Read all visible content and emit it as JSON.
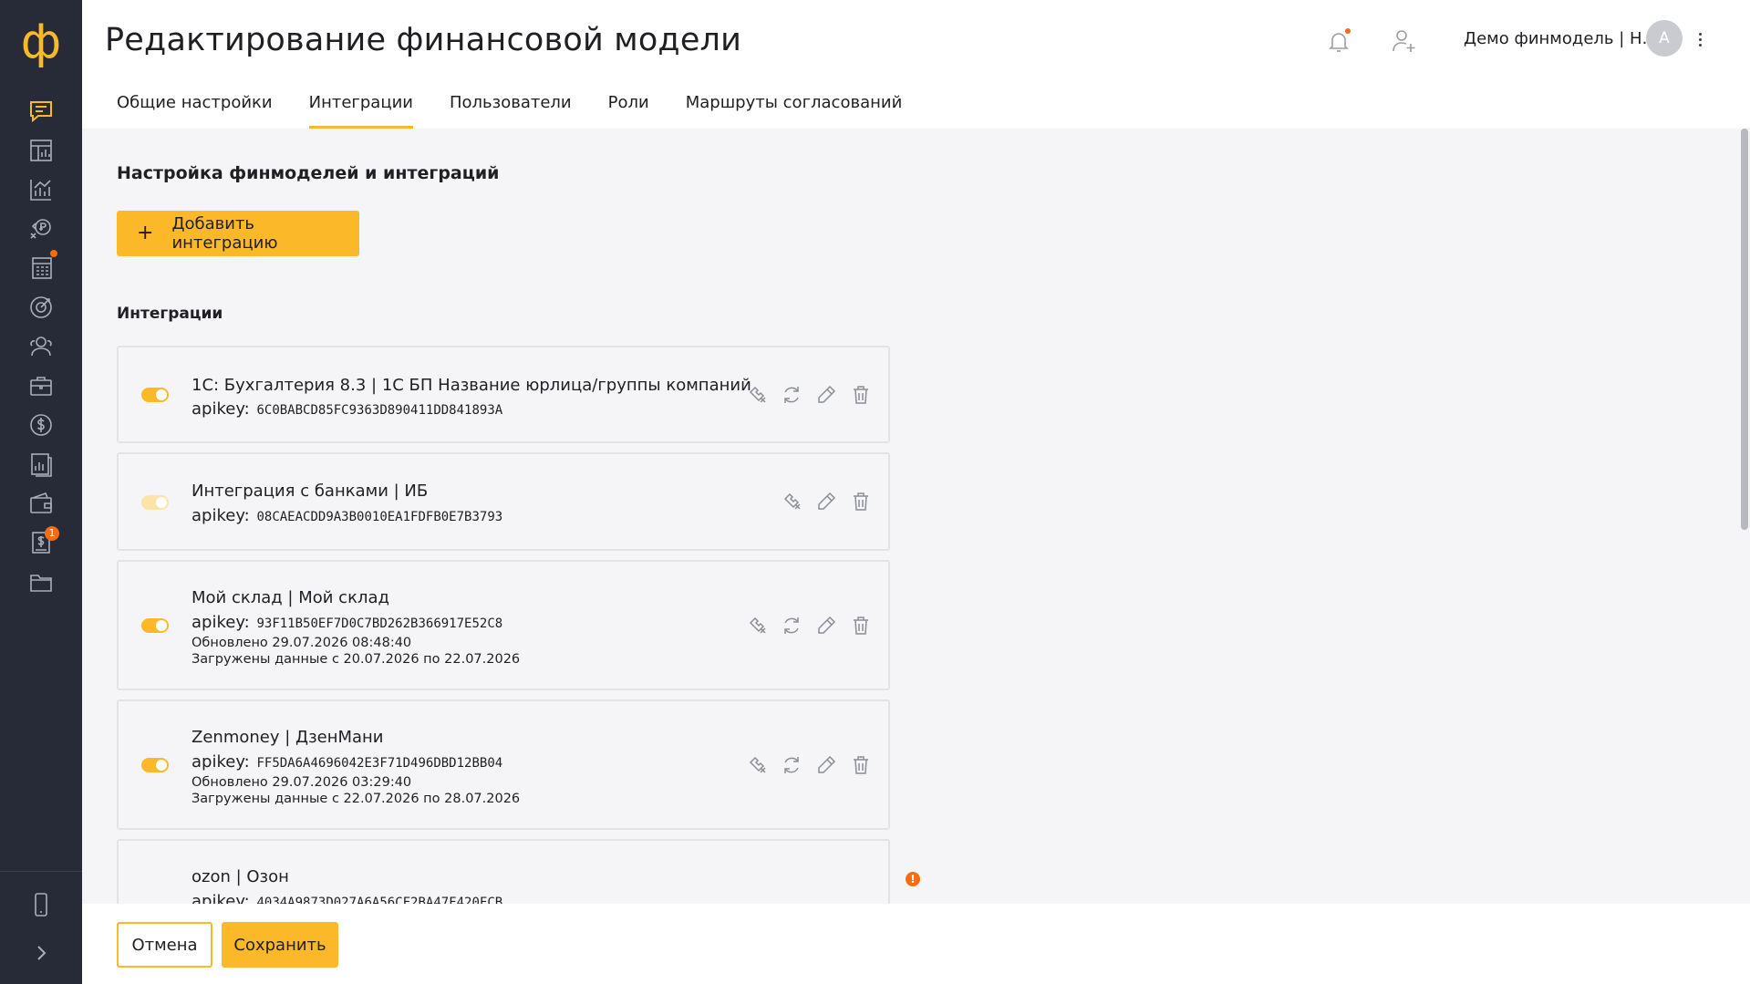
{
  "sidebar": {
    "logo": "ф",
    "icons": [
      {
        "name": "messages-icon",
        "active": true
      },
      {
        "name": "dashboard-icon"
      },
      {
        "name": "analytics-chart-icon"
      },
      {
        "name": "payments-exchange-icon",
        "dot": true
      },
      {
        "name": "budget-calculator-icon",
        "dot": true
      },
      {
        "name": "goals-target-icon"
      },
      {
        "name": "users-group-icon"
      },
      {
        "name": "briefcase-icon"
      },
      {
        "name": "dollar-coin-icon"
      },
      {
        "name": "reports-icon"
      },
      {
        "name": "wallet-icon"
      },
      {
        "name": "invoices-icon",
        "badge": "1"
      },
      {
        "name": "folder-icon"
      }
    ],
    "bottom": [
      {
        "name": "mobile-app-icon"
      },
      {
        "name": "expand-chevron-icon"
      }
    ],
    "invoices_badge": "1"
  },
  "header": {
    "title": "Редактирование финансовой модели",
    "account_name": "Демо финмодель | Н...",
    "avatar_letter": "А"
  },
  "tabs": [
    {
      "label": "Общие настройки",
      "active": false
    },
    {
      "label": "Интеграции",
      "active": true
    },
    {
      "label": "Пользователи",
      "active": false
    },
    {
      "label": "Роли",
      "active": false
    },
    {
      "label": "Маршруты согласований",
      "active": false
    }
  ],
  "main": {
    "section_title": "Настройка финмоделей и интеграций",
    "add_button": {
      "plus": "+",
      "label": "Добавить интеграцию"
    },
    "integrations_title": "Интеграции"
  },
  "integrations": [
    {
      "title": "1С: Бухгалтерия 8.3 | 1С БП Название юрлица/группы компаний",
      "apikey_label": "apikey:",
      "apikey": "6C0BABCD85FC9363D890411DD841893A",
      "enabled": true,
      "actions": [
        "settings",
        "sync",
        "edit",
        "delete"
      ]
    },
    {
      "title": "Интеграция с банками | ИБ",
      "apikey_label": "apikey:",
      "apikey": "08CAEACDD9A3B0010EA1FDFB0E7B3793",
      "enabled": false,
      "actions": [
        "settings",
        "edit",
        "delete"
      ]
    },
    {
      "title": "Мой склад | Мой склад",
      "apikey_label": "apikey:",
      "apikey": "93F11B50EF7D0C7BD262B366917E52C8",
      "updated": "Обновлено 29.07.2026 08:48:40",
      "loaded": "Загружены данные с 20.07.2026 по 22.07.2026",
      "enabled": true,
      "actions": [
        "settings",
        "sync",
        "edit",
        "delete"
      ]
    },
    {
      "title": "Zenmoney | ДзенМани",
      "apikey_label": "apikey:",
      "apikey": "FF5DA6A4696042E3F71D496DBD12BB04",
      "updated": "Обновлено 29.07.2026 03:29:40",
      "loaded": "Загружены данные с 22.07.2026 по 28.07.2026",
      "enabled": true,
      "actions": [
        "settings",
        "sync",
        "edit",
        "delete"
      ]
    },
    {
      "title": "ozon | Озон",
      "apikey_label": "apikey:",
      "apikey": "4034A9873D027A6A56CF2BA47F420FCB",
      "warning": "!",
      "enabled": true
    }
  ],
  "footer": {
    "cancel_label": "Отмена",
    "save_label": "Сохранить"
  },
  "colors": {
    "accent": "#fbb92a",
    "sidebar_bg": "#262b37",
    "alert": "#f36d13",
    "content_bg": "#f5f5f7"
  }
}
